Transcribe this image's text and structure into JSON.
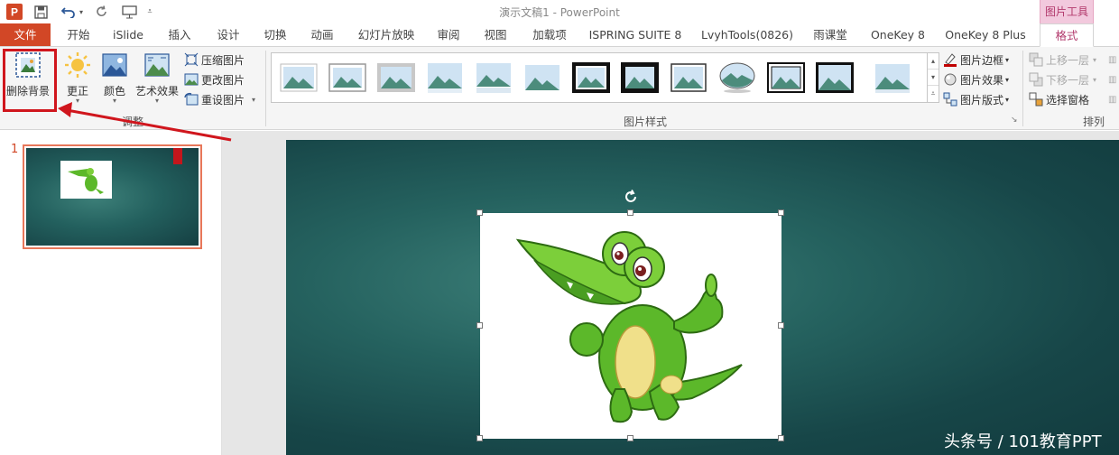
{
  "window": {
    "title": "演示文稿1 - PowerPoint",
    "context_group": "图片工具"
  },
  "tabs": [
    {
      "label": "文件"
    },
    {
      "label": "开始"
    },
    {
      "label": "iSlide"
    },
    {
      "label": "插入"
    },
    {
      "label": "设计"
    },
    {
      "label": "切换"
    },
    {
      "label": "动画"
    },
    {
      "label": "幻灯片放映"
    },
    {
      "label": "审阅"
    },
    {
      "label": "视图"
    },
    {
      "label": "加载项"
    },
    {
      "label": "ISPRING SUITE 8"
    },
    {
      "label": "LvyhTools(0826)"
    },
    {
      "label": "雨课堂"
    },
    {
      "label": "OneKey 8"
    },
    {
      "label": "OneKey 8 Plus"
    },
    {
      "label": "格式"
    }
  ],
  "ribbon": {
    "adjust": {
      "label": "调整",
      "remove_bg": "删除背景",
      "corrections": "更正",
      "color": "颜色",
      "artistic": "艺术效果",
      "compress": "压缩图片",
      "change": "更改图片",
      "reset": "重设图片"
    },
    "styles": {
      "label": "图片样式",
      "border": "图片边框",
      "effects": "图片效果",
      "layout": "图片版式"
    },
    "arrange": {
      "label": "排列",
      "bring_forward": "上移一层",
      "send_backward": "下移一层",
      "selection_pane": "选择窗格"
    }
  },
  "thumbnails": [
    {
      "number": "1"
    }
  ],
  "watermark": "头条号 / 101教育PPT",
  "colors": {
    "file_tab": "#d24726",
    "format_tab_text": "#b2396c",
    "highlight_box": "#d0161d",
    "slide_bg": "#1f5a5a",
    "thumb_border": "#e8775a"
  }
}
